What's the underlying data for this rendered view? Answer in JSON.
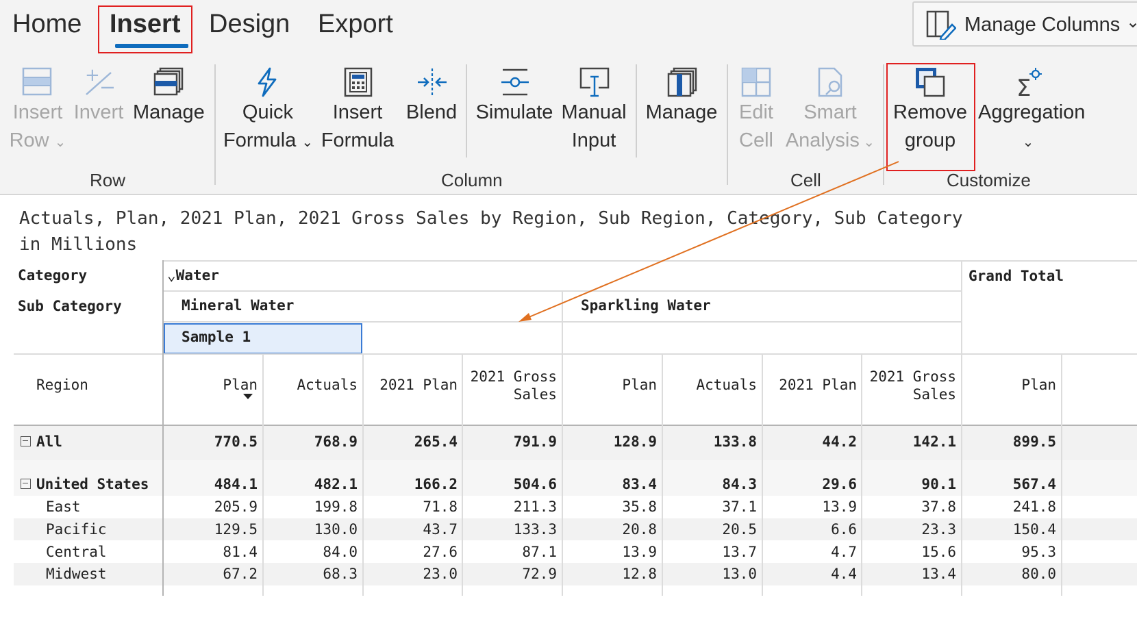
{
  "tabs": [
    {
      "label": "Home"
    },
    {
      "label": "Insert"
    },
    {
      "label": "Design"
    },
    {
      "label": "Export"
    }
  ],
  "manage_columns": {
    "label": "Manage Columns",
    "chevron": "⌄"
  },
  "ribbon": {
    "row_group": {
      "label": "Row",
      "insert_row": {
        "line1": "Insert",
        "line2": "Row"
      },
      "invert": {
        "line1": "Invert"
      },
      "manage": {
        "line1": "Manage"
      }
    },
    "column_group": {
      "label": "Column",
      "quick_formula": {
        "line1": "Quick",
        "line2": "Formula"
      },
      "insert_formula": {
        "line1": "Insert",
        "line2": "Formula"
      },
      "blend": {
        "line1": "Blend"
      },
      "simulate": {
        "line1": "Simulate"
      },
      "manual_input": {
        "line1": "Manual",
        "line2": "Input"
      },
      "manage": {
        "line1": "Manage"
      }
    },
    "cell_group": {
      "label": "Cell",
      "edit_cell": {
        "line1": "Edit",
        "line2": "Cell"
      },
      "smart_analysis": {
        "line1": "Smart",
        "line2": "Analysis"
      }
    },
    "customize_group": {
      "label": "Customize",
      "remove_group": {
        "line1": "Remove",
        "line2": "group"
      },
      "aggregation": {
        "line1": "Aggregation"
      }
    }
  },
  "description": {
    "line1": "Actuals, Plan, 2021 Plan, 2021 Gross Sales by Region, Sub Region, Category, Sub Category",
    "line2": "in Millions"
  },
  "pivot": {
    "category_label": "Category",
    "sub_category_label": "Sub Category",
    "region_label": "Region",
    "water_label": "Water",
    "mineral_water": "Mineral Water",
    "sparkling_water": "Sparkling Water",
    "grand_total": "Grand Total",
    "sample_group": "Sample 1",
    "measures": {
      "plan": "Plan",
      "actuals": "Actuals",
      "plan_2021": "2021 Plan",
      "gross_2021_line1": "2021 Gross",
      "gross_2021_line2": "Sales"
    },
    "rows": [
      {
        "label": "All",
        "values": [
          "770.5",
          "768.9",
          "265.4",
          "791.9",
          "128.9",
          "133.8",
          "44.2",
          "142.1",
          "899.5"
        ]
      },
      {
        "label": "United States",
        "values": [
          "484.1",
          "482.1",
          "166.2",
          "504.6",
          "83.4",
          "84.3",
          "29.6",
          "90.1",
          "567.4"
        ]
      },
      {
        "label": "East",
        "values": [
          "205.9",
          "199.8",
          "71.8",
          "211.3",
          "35.8",
          "37.1",
          "13.9",
          "37.8",
          "241.8"
        ]
      },
      {
        "label": "Pacific",
        "values": [
          "129.5",
          "130.0",
          "43.7",
          "133.3",
          "20.8",
          "20.5",
          "6.6",
          "23.3",
          "150.4"
        ]
      },
      {
        "label": "Central",
        "values": [
          "81.4",
          "84.0",
          "27.6",
          "87.1",
          "13.9",
          "13.7",
          "4.7",
          "15.6",
          "95.3"
        ]
      },
      {
        "label": "Midwest",
        "values": [
          "67.2",
          "68.3",
          "23.0",
          "72.9",
          "12.8",
          "13.0",
          "4.4",
          "13.4",
          "80.0"
        ]
      }
    ]
  },
  "colors": {
    "accent": "#0f6cbd",
    "highlight": "#e02020",
    "annotation_arrow": "#e07020"
  }
}
